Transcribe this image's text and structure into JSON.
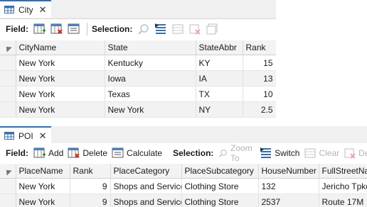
{
  "colors": {
    "accent": "#2f6fb5",
    "header_bg": "#f3f3f3",
    "alt_row": "#f2f2f2",
    "disabled_text": "#b3b3b3"
  },
  "city": {
    "tab_title": "City",
    "field_label": "Field:",
    "selection_label": "Selection:",
    "columns": [
      "CityName",
      "State",
      "StateAbbr",
      "Rank"
    ],
    "rows": [
      [
        "New York",
        "Kentucky",
        "KY",
        "15"
      ],
      [
        "New York",
        "Iowa",
        "IA",
        "13"
      ],
      [
        "New York",
        "Texas",
        "TX",
        "10"
      ],
      [
        "New York",
        "New York",
        "NY",
        "2.5"
      ]
    ]
  },
  "poi": {
    "tab_title": "POI",
    "field_label": "Field:",
    "add_label": "Add",
    "delete_label": "Delete",
    "calculate_label": "Calculate",
    "selection_label": "Selection:",
    "zoom_to_label": "Zoom To",
    "switch_label": "Switch",
    "clear_label": "Clear",
    "delete_sel_label": "De",
    "columns": [
      "PlaceName",
      "Rank",
      "PlaceCategory",
      "PlaceSubcategory",
      "HouseNumber",
      "FullStreetName"
    ],
    "rows": [
      [
        "New York",
        "9",
        "Shops and Service",
        "Clothing Store",
        "132",
        "Jericho Tpke"
      ],
      [
        "New York",
        "9",
        "Shops and Service",
        "Clothing Store",
        "2537",
        "Route 17M"
      ]
    ]
  }
}
